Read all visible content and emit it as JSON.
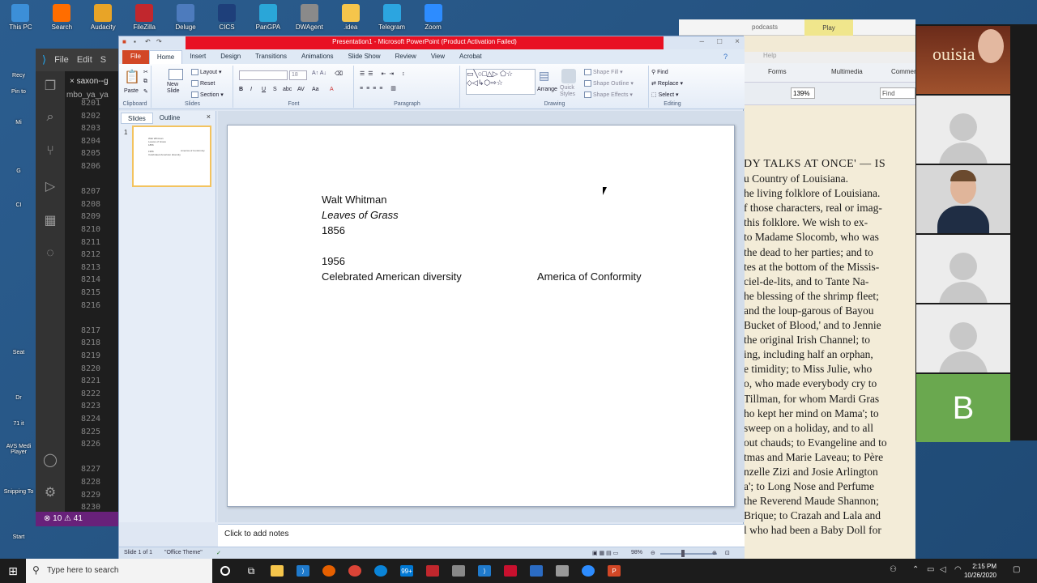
{
  "desktop": {
    "top_icons": [
      {
        "label": "This PC",
        "color": "#3c8fd8",
        "icon": "computer-icon"
      },
      {
        "label": "Search",
        "color": "#ff6d00",
        "icon": "search-app-icon"
      },
      {
        "label": "Audacity",
        "color": "#e8a427",
        "icon": "audacity-icon"
      },
      {
        "label": "FileZilla",
        "color": "#c1272d",
        "icon": "filezilla-icon"
      },
      {
        "label": "Deluge",
        "color": "#4d7bbd",
        "icon": "deluge-icon"
      },
      {
        "label": "CICS",
        "color": "#1e3f7a",
        "icon": "cics-icon"
      },
      {
        "label": "PanGPA",
        "color": "#2aa6d8",
        "icon": "globe-icon"
      },
      {
        "label": "DWAgent",
        "color": "#8a8a8a",
        "icon": "gear-icon"
      },
      {
        "label": ".idea",
        "color": "#f5c54b",
        "icon": "folder-icon"
      },
      {
        "label": "Telegram",
        "color": "#2ca5e0",
        "icon": "telegram-icon"
      },
      {
        "label": "Zoom",
        "color": "#2d8cff",
        "icon": "zoom-icon"
      }
    ],
    "left_labels": [
      "Recy",
      "Pin to",
      "Mi",
      "G",
      "CI",
      "Seat",
      "Dr",
      "71 it",
      "AVS Medi Player",
      "Snipping To",
      "Start"
    ]
  },
  "vscode": {
    "menu_file": "File",
    "menu_edit": "Edit",
    "menu_s": "S",
    "tab": "saxon--g",
    "crumb": "mbo_ya_ya",
    "line_numbers": [
      "8201",
      "8202",
      "8203",
      "8204",
      "8205",
      "8206",
      "",
      "8207",
      "8208",
      "8209",
      "8210",
      "8211",
      "8212",
      "8213",
      "8214",
      "8215",
      "8216",
      "",
      "8217",
      "8218",
      "8219",
      "8220",
      "8221",
      "8222",
      "8223",
      "8224",
      "8225",
      "8226",
      "",
      "8227",
      "8228",
      "8229",
      "8230"
    ],
    "status": "⊗ 10 ⚠ 41"
  },
  "ppt": {
    "title": "Presentation1 - Microsoft PowerPoint (Product Activation Failed)",
    "tabs": [
      "File",
      "Home",
      "Insert",
      "Design",
      "Transitions",
      "Animations",
      "Slide Show",
      "Review",
      "View",
      "Acrobat"
    ],
    "active_tab": "Home",
    "groups": {
      "clipboard": "Clipboard",
      "slides": "Slides",
      "font": "Font",
      "paragraph": "Paragraph",
      "drawing": "Drawing",
      "editing": "Editing"
    },
    "buttons": {
      "paste": "Paste",
      "new_slide": "New Slide",
      "layout": "Layout",
      "reset": "Reset",
      "section": "Section",
      "font_size": "18",
      "arrange": "Arrange",
      "quick_styles": "Quick Styles",
      "shape_fill": "Shape Fill",
      "shape_outline": "Shape Outline",
      "shape_effects": "Shape Effects",
      "find": "Find",
      "replace": "Replace",
      "select": "Select"
    },
    "pane_tabs": {
      "slides": "Slides",
      "outline": "Outline"
    },
    "slide_number": "1",
    "slide": {
      "left_lines": [
        "Walt Whitman",
        "Leaves of Grass",
        "1856",
        "",
        "1956",
        "Celebrated American diversity"
      ],
      "right_text": "America of Conformity"
    },
    "notes_placeholder": "Click to add notes",
    "status": {
      "slide": "Slide 1 of 1",
      "theme": "\"Office Theme\"",
      "zoom": "98%"
    }
  },
  "pdf": {
    "tab_title": "podcasts",
    "play": "Play",
    "menu_help": "Help",
    "tools": {
      "forms": "Forms",
      "multimedia": "Multimedia",
      "comment": "Comment",
      "zoom": "139%",
      "find": "Find"
    },
    "lines": [
      "DY TALKS AT ONCE' — IS",
      "u Country of Louisiana.",
      "he living folklore of Louisiana.",
      "f those characters, real or imag-",
      "this folklore.  We wish to ex-",
      "to Madame Slocomb, who was",
      "the dead to her parties; and to",
      "tes at the bottom of the Missis-",
      "ciel-de-lits, and to Tante Na-",
      "he blessing of the shrimp fleet;",
      "and the loup-garous of Bayou",
      "Bucket of Blood,' and to Jennie",
      "the original Irish Channel; to",
      "ing, including half an orphan,",
      "e timidity; to Miss Julie, who",
      "o, who made everybody cry to",
      "Tillman, for whom Mardi Gras",
      "ho kept her mind on Mama'; to",
      "sweep on a holiday, and to all",
      "out chauds; to Evangeline and to",
      "tmas and Marie Laveau; to Père",
      "nzelle Zizi and Josie Arlington",
      "a'; to Long Nose and Perfume",
      "the Reverend Maude Shannon;",
      "Brique; to Crazah and Lala and",
      "l who had been a Baby Doll for"
    ]
  },
  "zoom": {
    "video_overlay": "ouisia",
    "tile_b": "B"
  },
  "taskbar": {
    "search_placeholder": "Type here to search",
    "badge": "99+",
    "time": "2:15 PM",
    "date": "10/26/2020"
  }
}
